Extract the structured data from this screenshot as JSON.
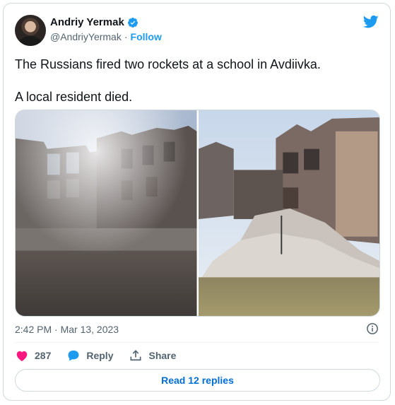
{
  "author": {
    "name": "Andriy Yermak",
    "handle": "@AndriyYermak",
    "separator": "·",
    "follow_label": "Follow"
  },
  "tweet": {
    "paragraphs": [
      "The Russians fired two rockets at a school in Avdiivka.",
      "A local resident died."
    ],
    "timestamp": "2:42 PM · Mar 13, 2023"
  },
  "stats": {
    "likes": "287",
    "reply_label": "Reply",
    "share_label": "Share"
  },
  "read_replies_label": "Read 12 replies",
  "colors": {
    "brand": "#1d9bf0",
    "like": "#f91880",
    "text": "#0f1419",
    "muted": "#536471"
  },
  "icons": [
    "verified-badge-icon",
    "twitter-bird-icon",
    "info-icon",
    "heart-icon",
    "reply-bubble-icon",
    "share-icon"
  ]
}
